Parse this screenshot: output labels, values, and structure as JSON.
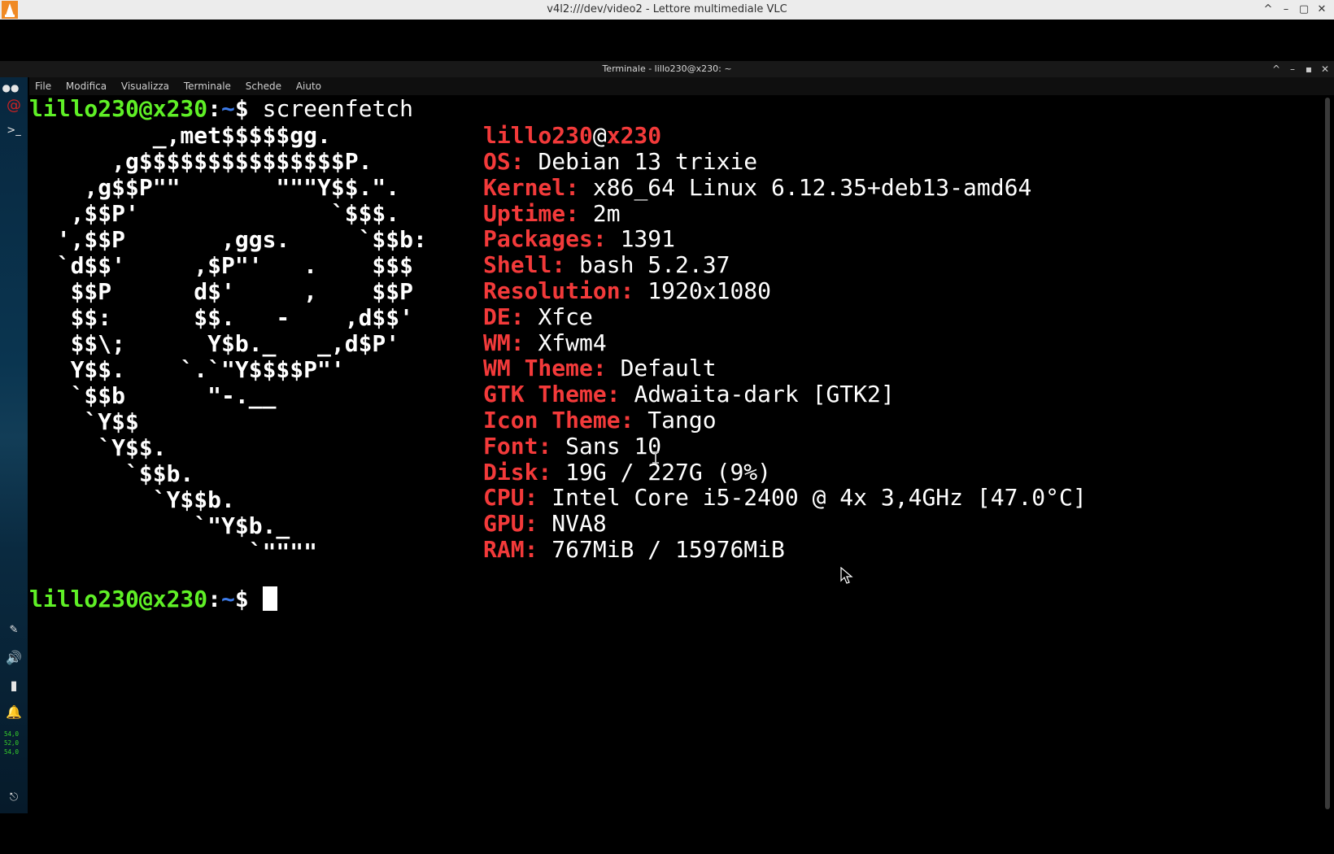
{
  "vlc_window": {
    "title": "v4l2:///dev/video2 - Lettore multimediale VLC",
    "controls": [
      "^",
      "–",
      "▢",
      "✕"
    ]
  },
  "terminal_window": {
    "title": "Terminale - lillo230@x230: ~",
    "menu": [
      "File",
      "Modifica",
      "Visualizza",
      "Terminale",
      "Schede",
      "Aiuto"
    ]
  },
  "left_panel": {
    "icons": [
      "debian-swirl-icon",
      "terminal-icon",
      "pen-icon",
      "volume-icon",
      "battery-icon",
      "bell-icon",
      "logout-icon"
    ],
    "temperatures": [
      "54,0",
      "52,0",
      "54,0"
    ]
  },
  "prompt": {
    "user_host": "lillo230@x230",
    "colon": ":",
    "dir": "~",
    "dollar": "$",
    "command": "screenfetch"
  },
  "ascii_art": [
    "         _,met$$$$$gg.",
    "      ,g$$$$$$$$$$$$$$$P.",
    "    ,g$$P\"\"       \"\"\"Y$$.\".",
    "   ,$$P'              `$$$.",
    "  ',$$P       ,ggs.     `$$b:",
    "  `d$$'     ,$P\"'   .    $$$",
    "   $$P      d$'     ,    $$P",
    "   $$:      $$.   -    ,d$$'",
    "   $$\\;      Y$b._   _,d$P'",
    "   Y$$.    `.`\"Y$$$$P\"'",
    "   `$$b      \"-.__",
    "    `Y$$",
    "     `Y$$.",
    "       `$$b.",
    "         `Y$$b.",
    "            `\"Y$b._",
    "                `\"\"\"\""
  ],
  "sysinfo": {
    "host_user": "lillo230",
    "host_at": "@",
    "host_name": "x230",
    "items": [
      {
        "label": "OS:",
        "value": "Debian 13 trixie"
      },
      {
        "label": "Kernel:",
        "value": "x86_64 Linux 6.12.35+deb13-amd64"
      },
      {
        "label": "Uptime:",
        "value": "2m"
      },
      {
        "label": "Packages:",
        "value": "1391"
      },
      {
        "label": "Shell:",
        "value": "bash 5.2.37"
      },
      {
        "label": "Resolution:",
        "value": "1920x1080"
      },
      {
        "label": "DE:",
        "value": "Xfce"
      },
      {
        "label": "WM:",
        "value": "Xfwm4"
      },
      {
        "label": "WM Theme:",
        "value": "Default"
      },
      {
        "label": "GTK Theme:",
        "value": "Adwaita-dark [GTK2]"
      },
      {
        "label": "Icon Theme:",
        "value": "Tango"
      },
      {
        "label": "Font:",
        "value": "Sans 10"
      },
      {
        "label": "Disk:",
        "value": "19G / 227G (9%)"
      },
      {
        "label": "CPU:",
        "value": "Intel Core i5-2400 @ 4x 3,4GHz [47.0°C]"
      },
      {
        "label": "GPU:",
        "value": "NVA8"
      },
      {
        "label": "RAM:",
        "value": "767MiB / 15976MiB"
      }
    ]
  },
  "colors": {
    "prompt_user": "#5ff026",
    "prompt_dir": "#3d7be8",
    "info_label": "#f33a3a",
    "vlc_titlebar": "#ececec"
  }
}
